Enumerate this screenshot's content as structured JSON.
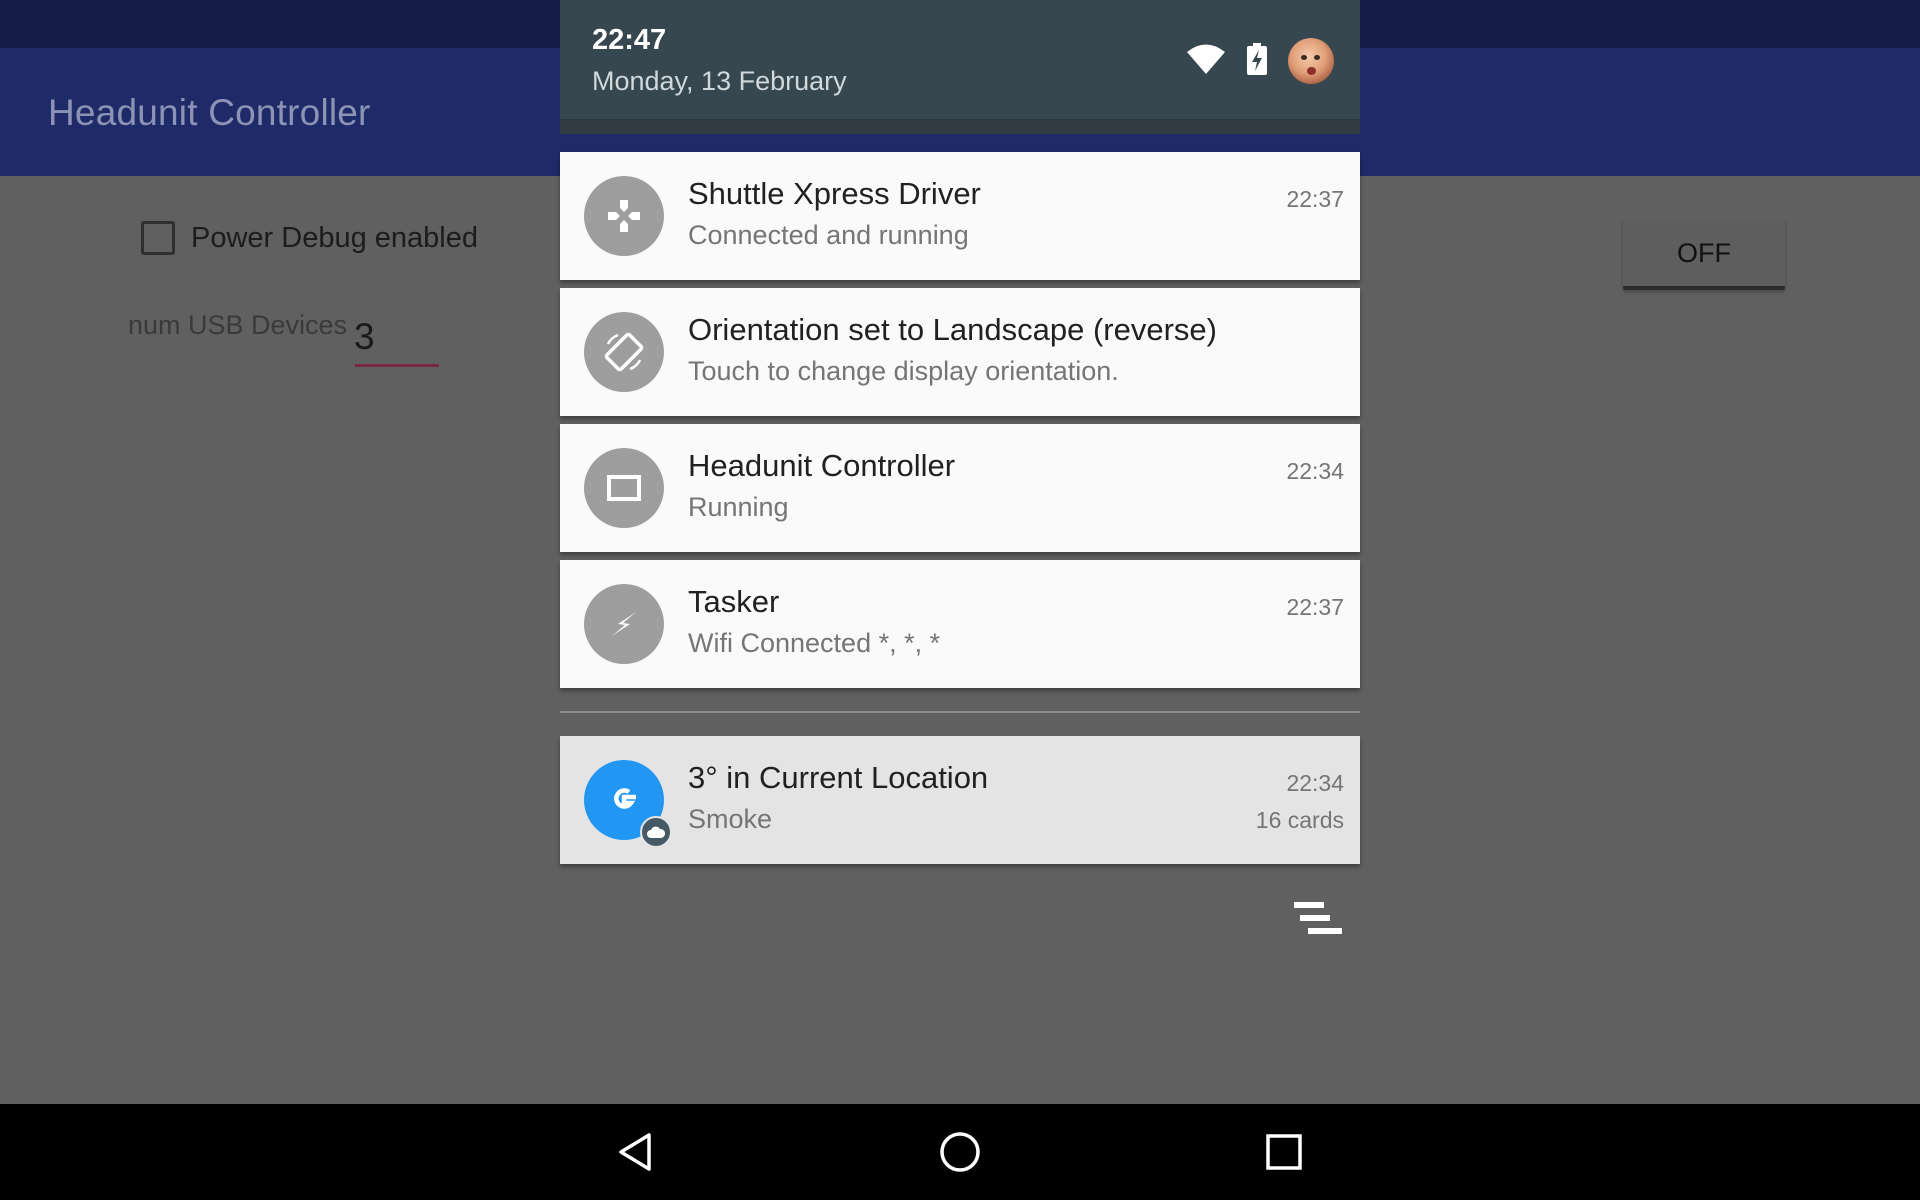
{
  "app": {
    "title": "Headunit Controller",
    "power_debug_label": "Power Debug enabled",
    "power_debug_checked": false,
    "usb_label": "num USB Devices",
    "usb_value": "3",
    "off_button_label": "OFF"
  },
  "shade": {
    "time": "22:47",
    "date": "Monday, 13 February",
    "status_icons": [
      "wifi-icon",
      "battery-charging-icon",
      "user-avatar"
    ]
  },
  "notifications": [
    {
      "icon": "gamepad-icon",
      "title": "Shuttle Xpress Driver",
      "text": "Connected and running",
      "time": "22:37"
    },
    {
      "icon": "screen-rotation-icon",
      "title": "Orientation set to Landscape (reverse)",
      "text": "Touch to change display orientation.",
      "time": ""
    },
    {
      "icon": "screen-icon",
      "title": "Headunit Controller",
      "text": "Running",
      "time": "22:34"
    },
    {
      "icon": "lightning-icon",
      "title": "Tasker",
      "text": "Wifi Connected *, *, *",
      "time": "22:37"
    }
  ],
  "google_card": {
    "icon": "google-g-icon",
    "badge_icon": "cloud-icon",
    "title": "3° in Current Location",
    "text": "Smoke",
    "time": "22:34",
    "extra": "16 cards",
    "accent": "#2196f3"
  },
  "clear_all_icon": "clear-all-icon",
  "navbar": [
    "back-icon",
    "home-icon",
    "recents-icon"
  ],
  "colors": {
    "shade_header": "#37474f",
    "toolbar": "#1f2a69",
    "scrim_background": "#606060",
    "card": "#fafafa"
  }
}
